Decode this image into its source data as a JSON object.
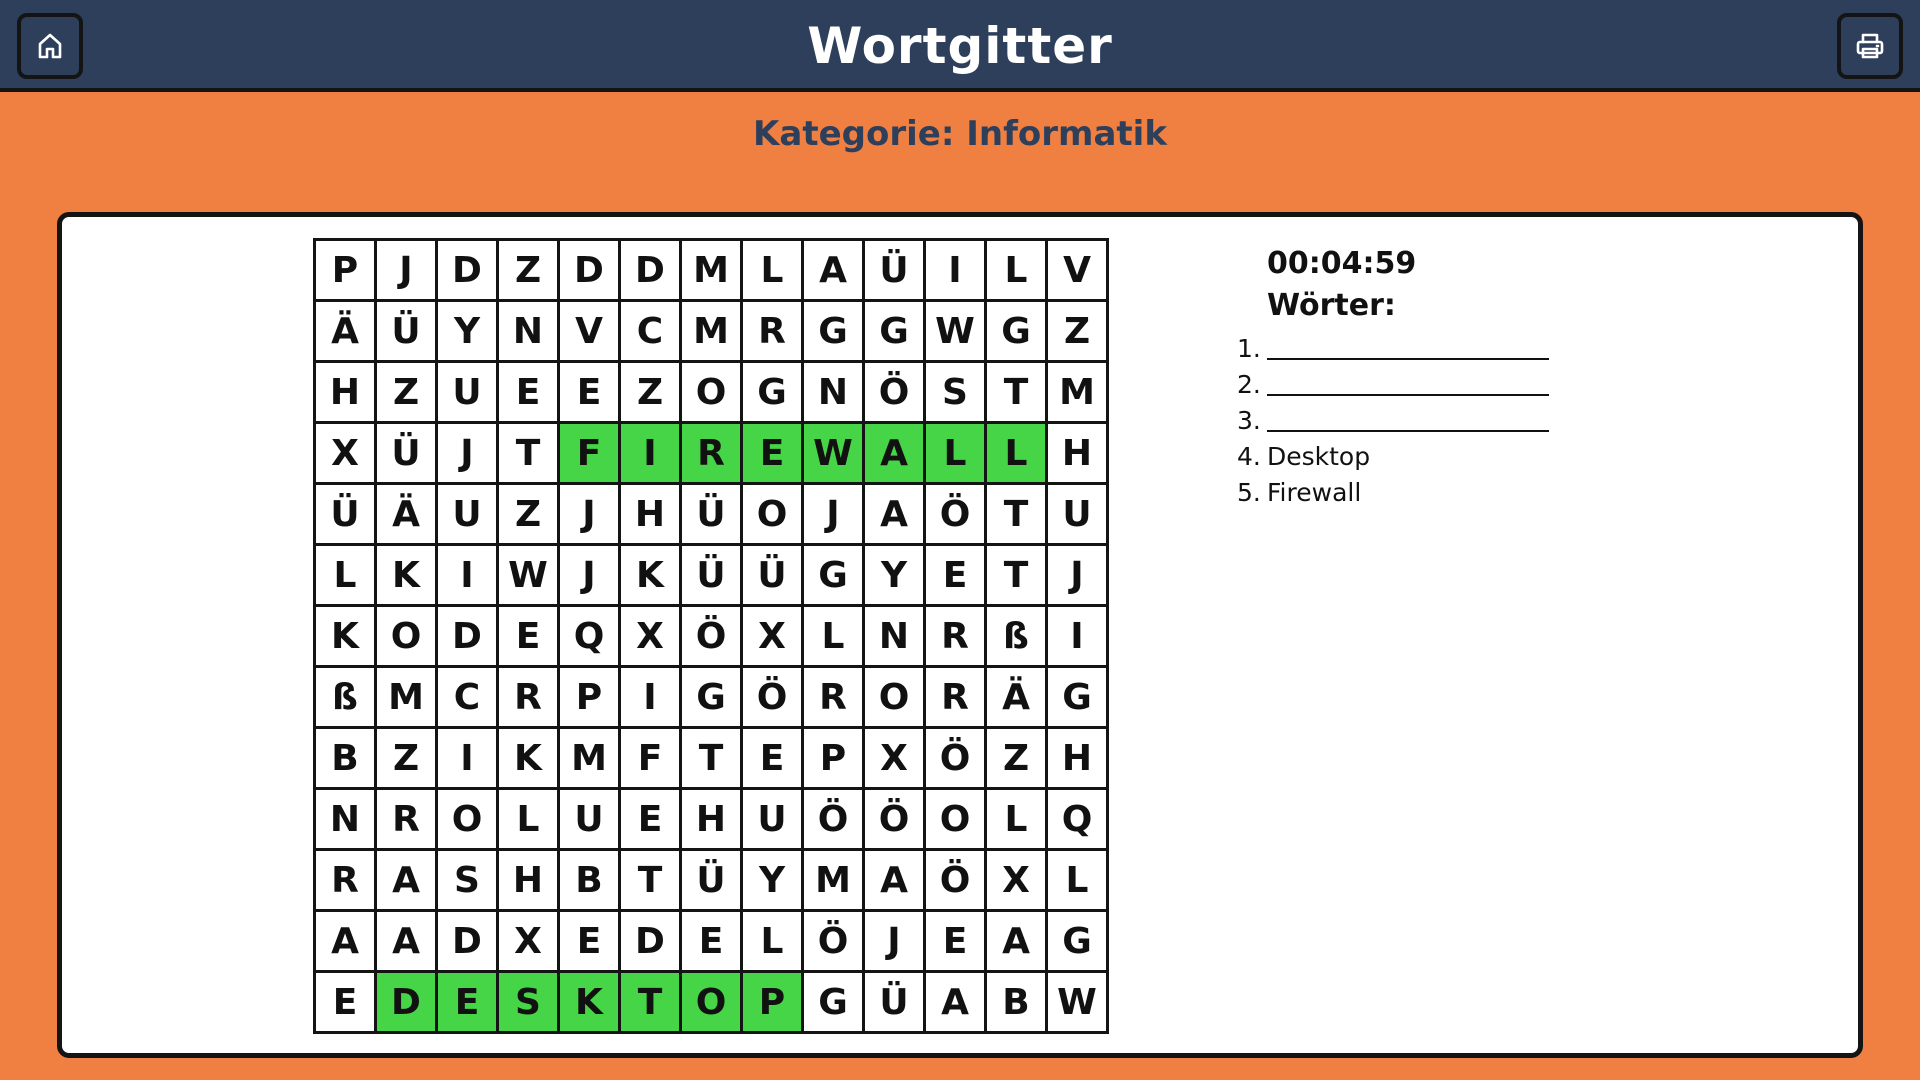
{
  "header": {
    "title": "Wortgitter",
    "home_icon": "home-icon",
    "print_icon": "printer-icon",
    "bar_color": "#2d3f5b"
  },
  "category_label": "Kategorie: Informatik",
  "page_background": "#f07f42",
  "highlight_color": "#46d546",
  "grid": {
    "rows": [
      [
        "P",
        "J",
        "D",
        "Z",
        "D",
        "D",
        "M",
        "L",
        "A",
        "Ü",
        "I",
        "L",
        "V"
      ],
      [
        "Ä",
        "Ü",
        "Y",
        "N",
        "V",
        "C",
        "M",
        "R",
        "G",
        "G",
        "W",
        "G",
        "Z"
      ],
      [
        "H",
        "Z",
        "U",
        "E",
        "E",
        "Z",
        "O",
        "G",
        "N",
        "Ö",
        "S",
        "T",
        "M"
      ],
      [
        "X",
        "Ü",
        "J",
        "T",
        "F",
        "I",
        "R",
        "E",
        "W",
        "A",
        "L",
        "L",
        "H"
      ],
      [
        "Ü",
        "Ä",
        "U",
        "Z",
        "J",
        "H",
        "Ü",
        "O",
        "J",
        "A",
        "Ö",
        "T",
        "U"
      ],
      [
        "L",
        "K",
        "I",
        "W",
        "J",
        "K",
        "Ü",
        "Ü",
        "G",
        "Y",
        "E",
        "T",
        "J"
      ],
      [
        "K",
        "O",
        "D",
        "E",
        "Q",
        "X",
        "Ö",
        "X",
        "L",
        "N",
        "R",
        "ß",
        "I"
      ],
      [
        "ß",
        "M",
        "C",
        "R",
        "P",
        "I",
        "G",
        "Ö",
        "R",
        "O",
        "R",
        "Ä",
        "G"
      ],
      [
        "B",
        "Z",
        "I",
        "K",
        "M",
        "F",
        "T",
        "E",
        "P",
        "X",
        "Ö",
        "Z",
        "H"
      ],
      [
        "N",
        "R",
        "O",
        "L",
        "U",
        "E",
        "H",
        "U",
        "Ö",
        "Ö",
        "O",
        "L",
        "Q"
      ],
      [
        "R",
        "A",
        "S",
        "H",
        "B",
        "T",
        "Ü",
        "Y",
        "M",
        "A",
        "Ö",
        "X",
        "L"
      ],
      [
        "A",
        "A",
        "D",
        "X",
        "E",
        "D",
        "E",
        "L",
        "Ö",
        "J",
        "E",
        "A",
        "G"
      ],
      [
        "E",
        "D",
        "E",
        "S",
        "K",
        "T",
        "O",
        "P",
        "G",
        "Ü",
        "A",
        "B",
        "W"
      ]
    ],
    "found_words": [
      {
        "word": "FIREWALL",
        "row": 3,
        "col_start": 4,
        "col_end": 11
      },
      {
        "word": "DESKTOP",
        "row": 12,
        "col_start": 1,
        "col_end": 7
      }
    ]
  },
  "sidebar": {
    "timer": "00:04:59",
    "words_heading": "Wörter:",
    "words": [
      {
        "number": "1.",
        "text": ""
      },
      {
        "number": "2.",
        "text": ""
      },
      {
        "number": "3.",
        "text": ""
      },
      {
        "number": "4.",
        "text": "Desktop"
      },
      {
        "number": "5.",
        "text": "Firewall"
      }
    ]
  }
}
